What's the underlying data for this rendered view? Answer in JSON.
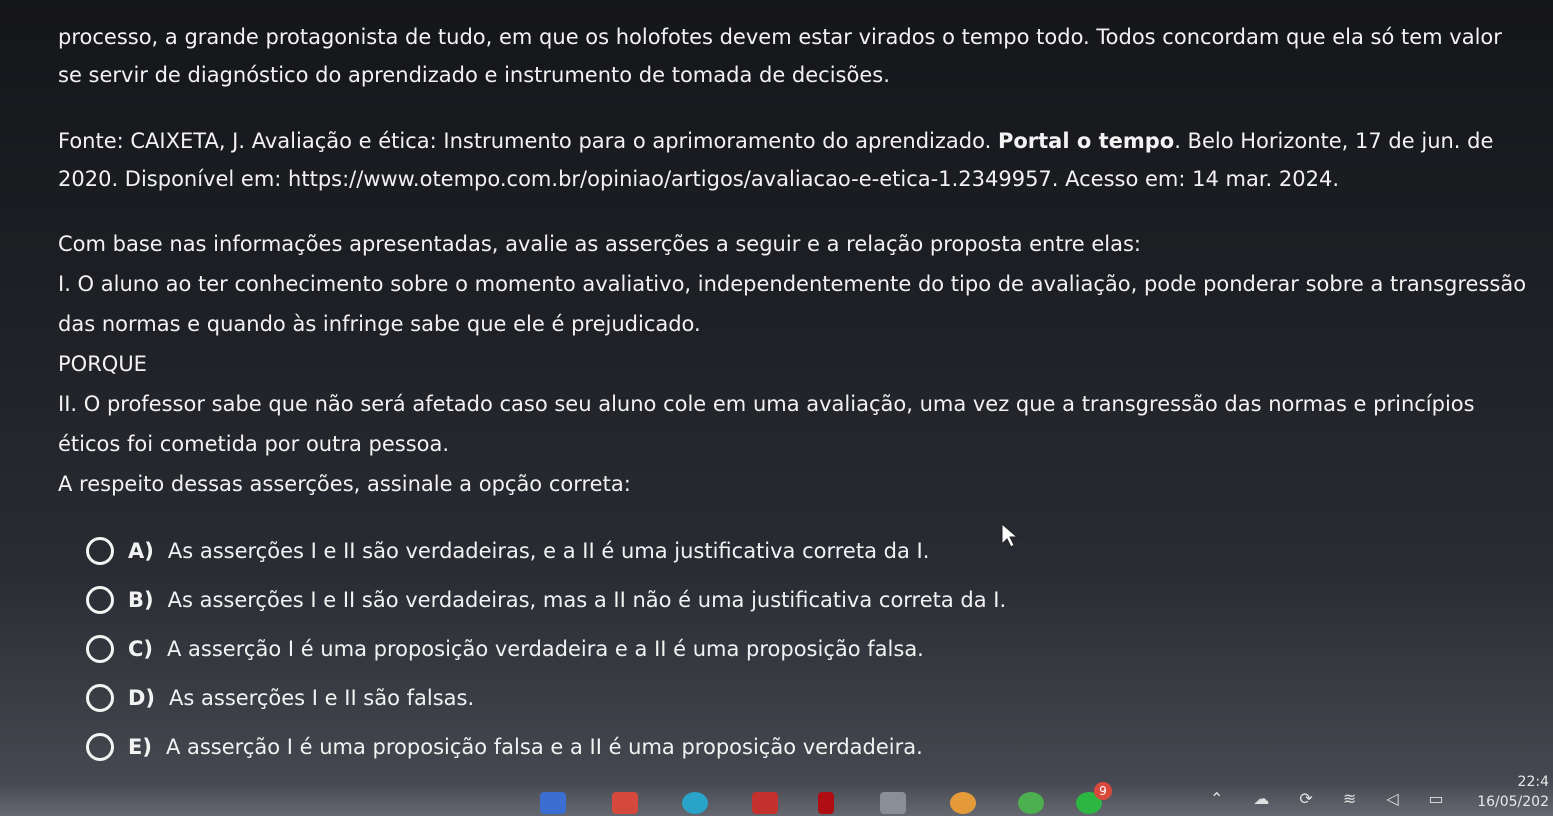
{
  "question": {
    "intro_text": "processo, a grande protagonista de tudo, em que os holofotes devem estar virados o tempo todo. Todos concordam que ela só tem valor se servir de diagnóstico do aprendizado e instrumento de tomada de decisões.",
    "source_prefix": "Fonte: CAIXETA, J. Avaliação e ética: Instrumento para o aprimoramento do aprendizado. ",
    "source_bold": "Portal o tempo",
    "source_suffix": ". Belo Horizonte, 17 de jun. de 2020. Disponível em: https://www.otempo.com.br/opiniao/artigos/avaliacao-e-etica-1.2349957. Acesso em: 14 mar. 2024.",
    "prompt": "Com base nas informações apresentadas, avalie as asserções a seguir e a relação proposta entre elas:",
    "assertion_1": "I. O aluno ao ter conhecimento sobre o momento avaliativo, independentemente do tipo de avaliação, pode ponderar sobre a transgressão das normas e quando às infringe sabe que ele é prejudicado.",
    "connector": "PORQUE",
    "assertion_2": "II. O professor sabe que não será afetado caso seu aluno cole em uma avaliação, uma vez que a transgressão das normas e princípios éticos foi cometida por outra pessoa.",
    "instruction": "A respeito dessas asserções, assinale a opção correta:",
    "options": [
      {
        "letter": "A)",
        "text": "As asserções I e II são verdadeiras, e a II é uma justificativa correta da I."
      },
      {
        "letter": "B)",
        "text": "As asserções I e II são verdadeiras, mas a II não é uma justificativa correta da I."
      },
      {
        "letter": "C)",
        "text": "A asserção I é uma proposição verdadeira e a II é uma proposição falsa."
      },
      {
        "letter": "D)",
        "text": "As asserções I e II são falsas."
      },
      {
        "letter": "E)",
        "text": "A asserção I é uma proposição falsa e a II é uma proposição verdadeira."
      }
    ]
  },
  "taskbar": {
    "time": "22:4",
    "date": "16/05/202",
    "notification_count": "9",
    "icons": [
      "files-icon",
      "gmail-icon",
      "edge-icon",
      "youtube-icon",
      "netflix-icon",
      "meet-icon",
      "game-icon",
      "chrome-icon",
      "whatsapp-icon"
    ],
    "tray_icons": [
      "chevron-up-icon",
      "cloud-icon",
      "sync-icon",
      "wifi-icon",
      "volume-icon",
      "battery-icon"
    ]
  }
}
